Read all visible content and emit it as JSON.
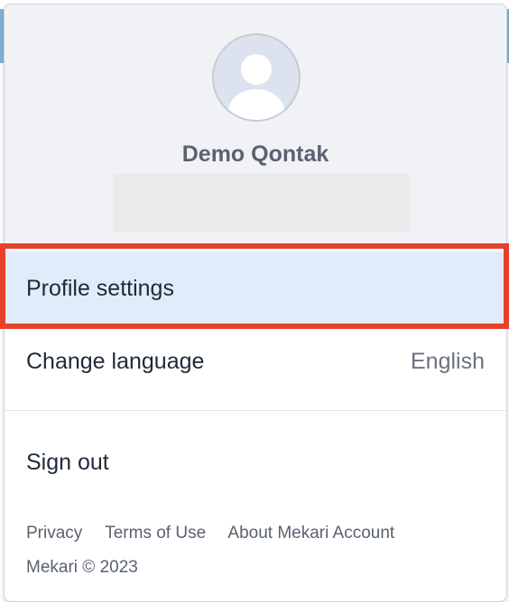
{
  "user": {
    "name": "Demo Qontak",
    "avatar_icon": "user-avatar-icon"
  },
  "menu": {
    "profile_settings": "Profile settings",
    "change_language": "Change language",
    "language_value": "English",
    "sign_out": "Sign out"
  },
  "footer": {
    "privacy": "Privacy",
    "terms": "Terms of Use",
    "about": "About Mekari Account",
    "copyright": "Mekari © 2023"
  },
  "colors": {
    "highlight_border": "#e8402c",
    "selected_item_bg": "#e1ecfa",
    "header_bg": "#f1f2f6"
  }
}
